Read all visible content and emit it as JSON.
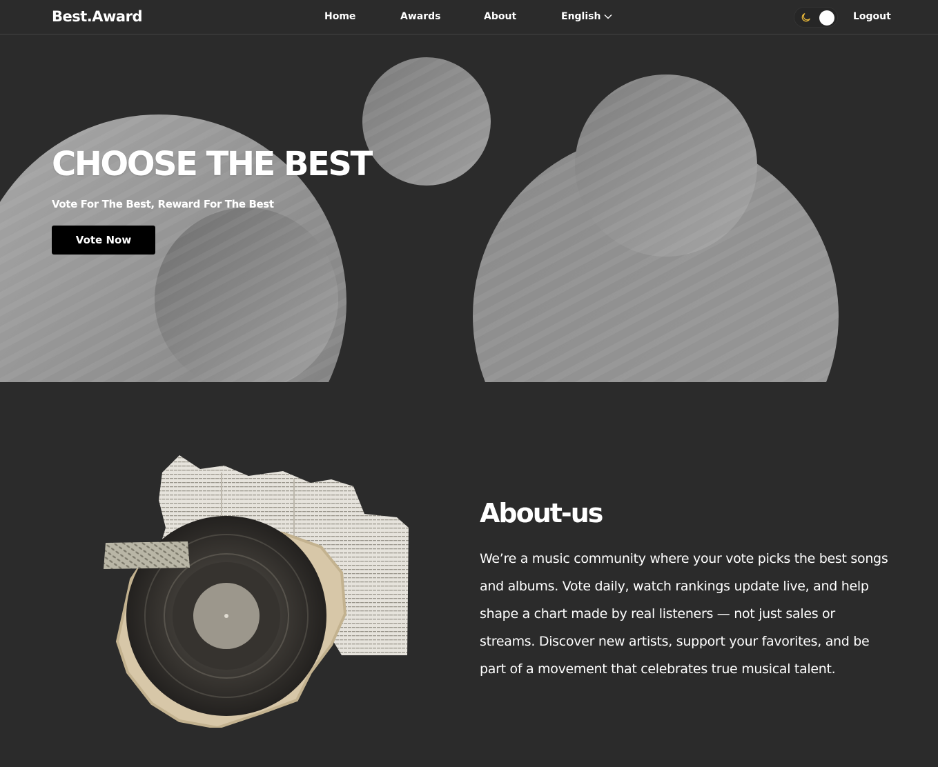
{
  "nav": {
    "brand": "Best.Award",
    "links": {
      "home": "Home",
      "awards": "Awards",
      "about": "About"
    },
    "language": "English",
    "logout": "Logout",
    "theme_icon": "moon-icon"
  },
  "hero": {
    "title": "CHOOSE THE BEST",
    "subtitle": "Vote For The Best, Reward For The Best",
    "cta": "Vote Now"
  },
  "about": {
    "title": "About-us",
    "body": "We’re a music community where your vote picks the best songs and albums. Vote daily, watch rankings update live, and help shape a chart made by real listeners — not just sales or streams. Discover new artists, support your favorites, and be part of a movement that celebrates true musical talent.",
    "image_icon": "vinyl-record-collage-icon"
  },
  "colors": {
    "background": "#2b2b2b",
    "button": "#000000",
    "moon": "#e8b739",
    "circle_light": "#9e9e9e",
    "circle_dark": "#7a7a7a"
  }
}
